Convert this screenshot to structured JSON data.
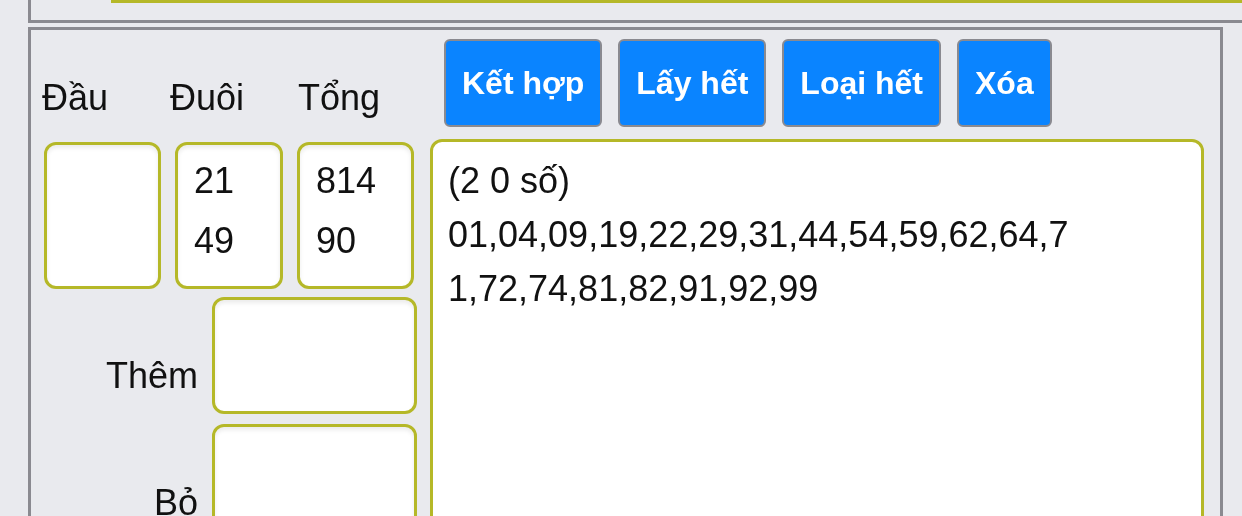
{
  "columns": [
    {
      "label": "Đầu"
    },
    {
      "label": "Đuôi",
      "lines": [
        "21",
        "49"
      ]
    },
    {
      "label": "Tổng",
      "lines": [
        "814",
        "90"
      ]
    }
  ],
  "buttons": [
    "Kết hợp",
    "Lấy hết",
    "Loại hết",
    "Xóa"
  ],
  "extra_fields": [
    {
      "label": "Thêm"
    },
    {
      "label": "Bỏ"
    }
  ],
  "result": {
    "lines": [
      "(2 0 số)",
      "01,04,09,19,22,29,31,44,54,59,62,64,7",
      "1,72,74,81,82,91,92,99"
    ]
  }
}
